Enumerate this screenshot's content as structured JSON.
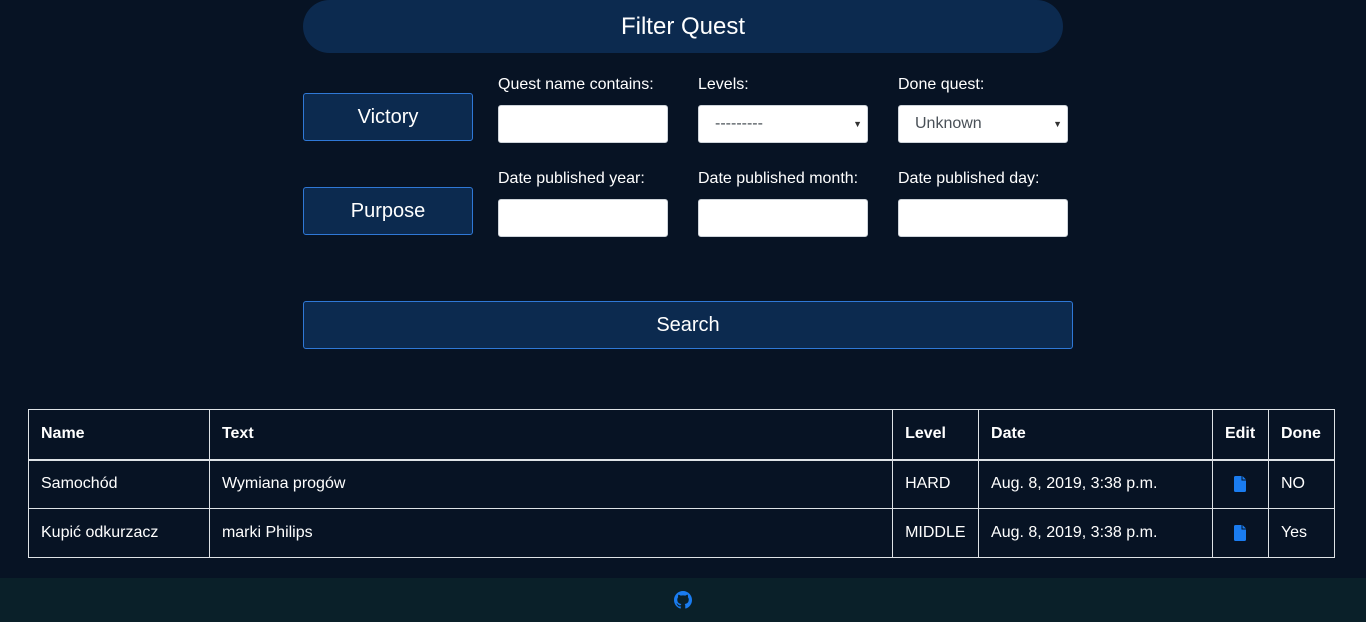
{
  "header": {
    "title": "Filter Quest"
  },
  "nav": {
    "victory_label": "Victory",
    "purpose_label": "Purpose"
  },
  "filters": {
    "quest_name_label": "Quest name contains:",
    "quest_name_value": "",
    "levels_label": "Levels:",
    "levels_selected": "---------",
    "done_label": "Done quest:",
    "done_selected": "Unknown",
    "year_label": "Date published year:",
    "year_value": "",
    "month_label": "Date published month:",
    "month_value": "",
    "day_label": "Date published day:",
    "day_value": ""
  },
  "search": {
    "label": "Search"
  },
  "table": {
    "headers": {
      "name": "Name",
      "text": "Text",
      "level": "Level",
      "date": "Date",
      "edit": "Edit",
      "done": "Done"
    },
    "rows": [
      {
        "name": "Samochód",
        "text": "Wymiana progów",
        "level": "HARD",
        "date": "Aug. 8, 2019, 3:38 p.m.",
        "edit_icon": "file-icon",
        "done": "NO"
      },
      {
        "name": "Kupić odkurzacz",
        "text": "marki Philips",
        "level": "MIDDLE",
        "date": "Aug. 8, 2019, 3:38 p.m.",
        "edit_icon": "file-icon",
        "done": "Yes"
      }
    ]
  },
  "footer": {
    "icon": "github-icon"
  },
  "colors": {
    "background": "#071324",
    "panel": "#0c2a4f",
    "accent": "#1a7cf0",
    "footer": "#0a2029"
  }
}
